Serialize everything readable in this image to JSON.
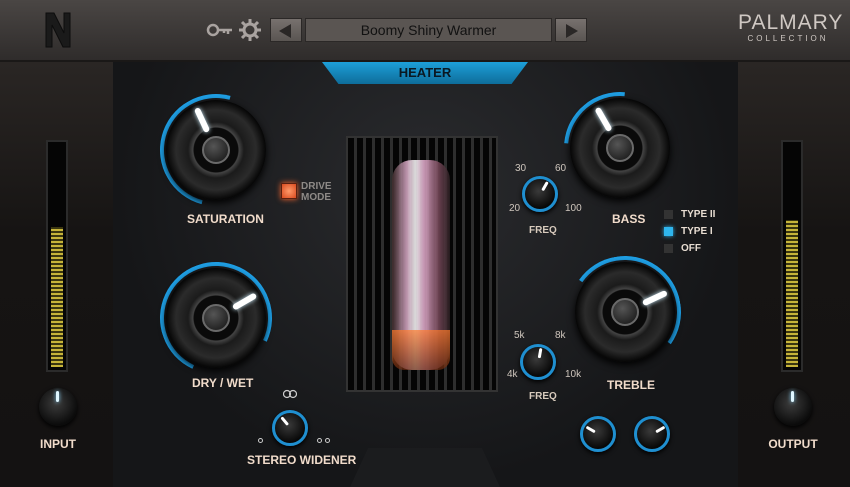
{
  "header": {
    "logo": "N",
    "preset_name": "Boomy Shiny Warmer",
    "brand_name": "PALMARY",
    "brand_sub": "COLLECTION"
  },
  "heater_tab": "HEATER",
  "left": {
    "input_label": "INPUT",
    "meter_level": 0.63
  },
  "right": {
    "output_label": "OUTPUT",
    "meter_level": 0.66
  },
  "saturation": {
    "label": "SATURATION",
    "drive_mode_line1": "DRIVE",
    "drive_mode_line2": "MODE"
  },
  "drywet": {
    "label": "DRY / WET"
  },
  "stereo": {
    "label": "STEREO WIDENER"
  },
  "bass": {
    "label": "BASS",
    "freq_label": "FREQ",
    "ticks": [
      "30",
      "60",
      "20",
      "100"
    ]
  },
  "treble": {
    "label": "TREBLE",
    "freq_label": "FREQ",
    "ticks": [
      "5k",
      "8k",
      "4k",
      "10k"
    ]
  },
  "type_options": [
    {
      "label": "TYPE II",
      "selected": false
    },
    {
      "label": "TYPE I",
      "selected": true
    },
    {
      "label": "OFF",
      "selected": false
    }
  ],
  "colors": {
    "accent": "#1fa0e6",
    "led": "#e85a2a",
    "meter": "#c6b43a"
  }
}
